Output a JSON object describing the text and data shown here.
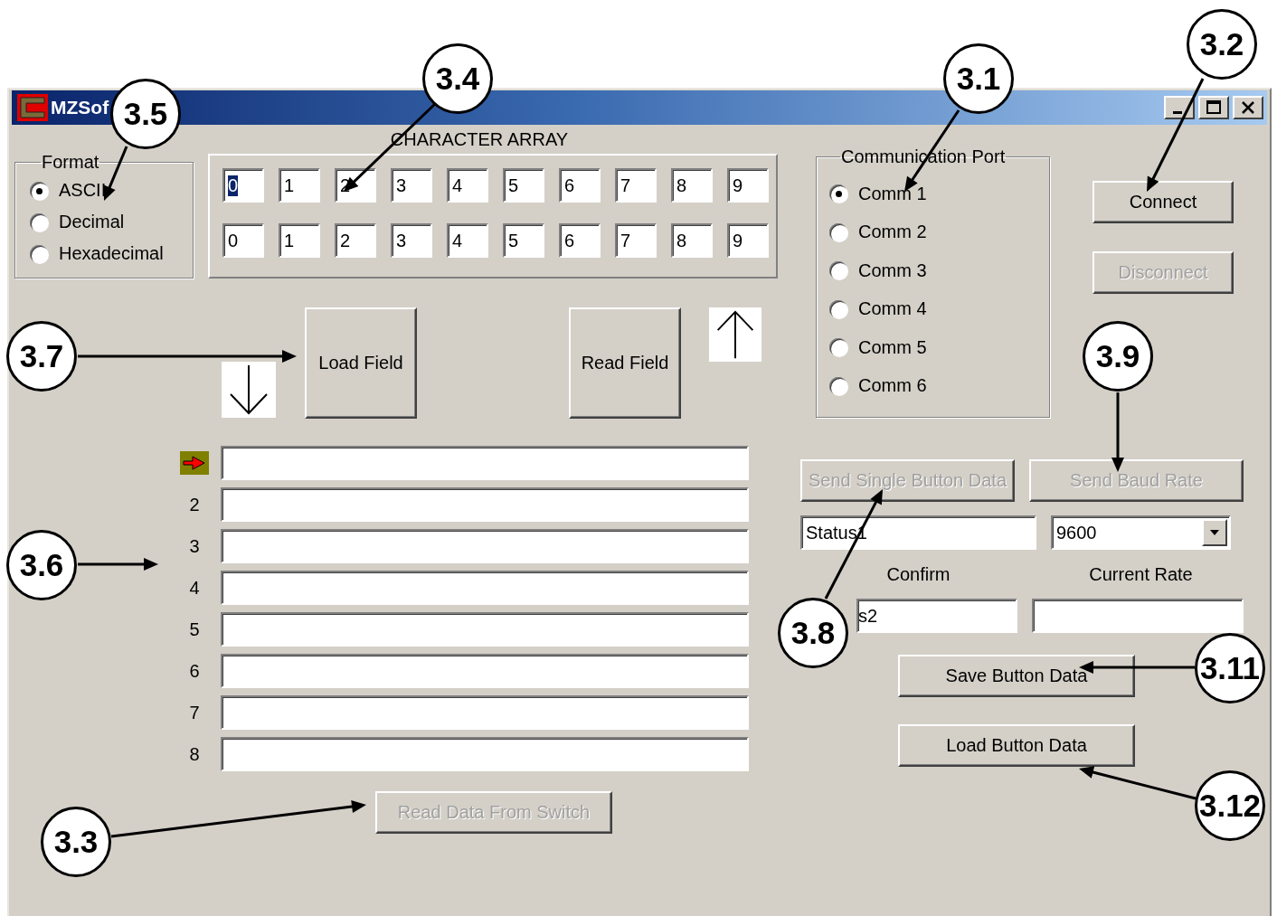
{
  "window": {
    "title": "MZSof"
  },
  "format": {
    "label": "Format",
    "options": [
      {
        "label": "ASCII",
        "selected": true
      },
      {
        "label": "Decimal",
        "selected": false
      },
      {
        "label": "Hexadecimal",
        "selected": false
      }
    ]
  },
  "character_array": {
    "title": "CHARACTER ARRAY",
    "rows": [
      [
        {
          "value": "0",
          "selected": true
        },
        {
          "value": "1",
          "selected": false
        },
        {
          "value": "2",
          "selected": false
        },
        {
          "value": "3",
          "selected": false
        },
        {
          "value": "4",
          "selected": false
        },
        {
          "value": "5",
          "selected": false
        },
        {
          "value": "6",
          "selected": false
        },
        {
          "value": "7",
          "selected": false
        },
        {
          "value": "8",
          "selected": false
        },
        {
          "value": "9",
          "selected": false
        }
      ],
      [
        {
          "value": "0",
          "selected": false
        },
        {
          "value": "1",
          "selected": false
        },
        {
          "value": "2",
          "selected": false
        },
        {
          "value": "3",
          "selected": false
        },
        {
          "value": "4",
          "selected": false
        },
        {
          "value": "5",
          "selected": false
        },
        {
          "value": "6",
          "selected": false
        },
        {
          "value": "7",
          "selected": false
        },
        {
          "value": "8",
          "selected": false
        },
        {
          "value": "9",
          "selected": false
        }
      ]
    ]
  },
  "load_field_button": {
    "label": "Load Field",
    "disabled": false
  },
  "read_field_button": {
    "label": "Read Field",
    "disabled": false
  },
  "fields": [
    {
      "kind": "pointer"
    },
    {
      "kind": "numbered",
      "label": "2"
    },
    {
      "kind": "numbered",
      "label": "3"
    },
    {
      "kind": "numbered",
      "label": "4"
    },
    {
      "kind": "numbered",
      "label": "5"
    },
    {
      "kind": "numbered",
      "label": "6"
    },
    {
      "kind": "numbered",
      "label": "7"
    },
    {
      "kind": "numbered",
      "label": "8"
    }
  ],
  "read_data_button": {
    "label": "Read Data From Switch",
    "disabled": true
  },
  "comm_port": {
    "label": "Communication Port",
    "options": [
      {
        "label": "Comm 1",
        "selected": true
      },
      {
        "label": "Comm 2",
        "selected": false
      },
      {
        "label": "Comm 3",
        "selected": false
      },
      {
        "label": "Comm 4",
        "selected": false
      },
      {
        "label": "Comm 5",
        "selected": false
      },
      {
        "label": "Comm 6",
        "selected": false
      }
    ]
  },
  "connect_button": {
    "label": "Connect",
    "disabled": false
  },
  "disconnect_button": {
    "label": "Disconnect",
    "disabled": true
  },
  "send_single_button": {
    "label": "Send Single Button Data",
    "disabled": true
  },
  "send_baud_button": {
    "label": "Send Baud Rate",
    "disabled": true
  },
  "confirm": {
    "value": "Status1",
    "label": "Confirm",
    "second_value": "s2"
  },
  "baud": {
    "value": "9600",
    "label": "Current Rate"
  },
  "save_button": {
    "label": "Save Button Data",
    "disabled": false
  },
  "load_button": {
    "label": "Load Button Data",
    "disabled": false
  },
  "callouts": [
    {
      "label": "3.5"
    },
    {
      "label": "3.4"
    },
    {
      "label": "3.1"
    },
    {
      "label": "3.2"
    },
    {
      "label": "3.7"
    },
    {
      "label": "3.9"
    },
    {
      "label": "3.6"
    },
    {
      "label": "3.8"
    },
    {
      "label": "3.11"
    },
    {
      "label": "3.12"
    },
    {
      "label": "3.3"
    }
  ]
}
